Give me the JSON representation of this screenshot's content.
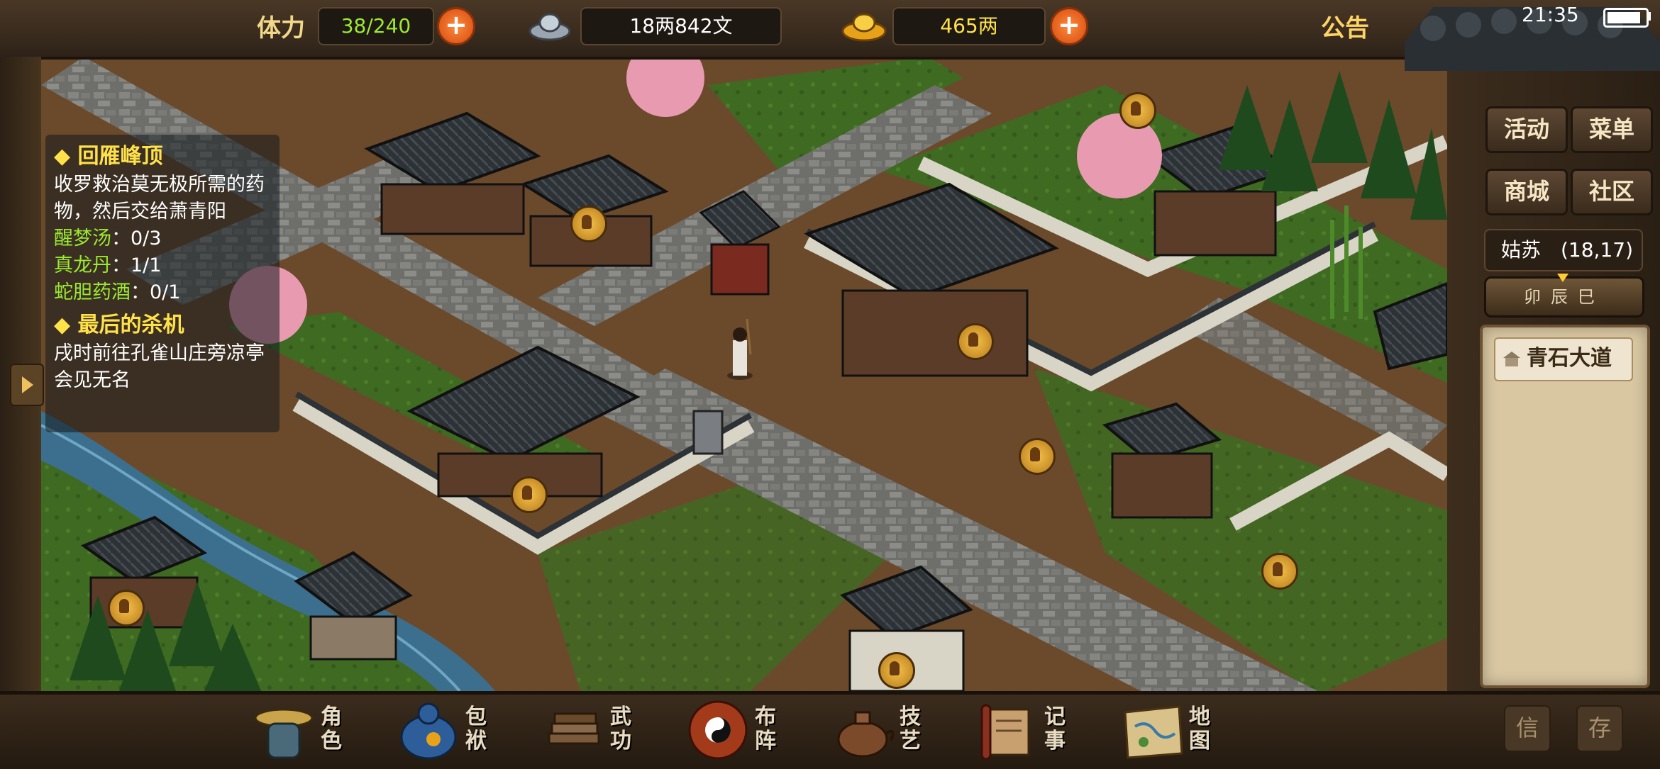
{
  "top_bar": {
    "stamina_label": "体力",
    "stamina_value": "38/240",
    "silver_value": "18两842文",
    "gold_value": "465两",
    "notice_label": "公告",
    "plus_symbol": "+",
    "clock": "21:35"
  },
  "quests": [
    {
      "title": "回雁峰顶",
      "desc": "收罗救治莫无极所需的药物，然后交给萧青阳",
      "items": [
        {
          "name": "醒梦汤",
          "count": "：0/3"
        },
        {
          "name": "真龙丹",
          "count": "：1/1"
        },
        {
          "name": "蛇胆药酒",
          "count": "：0/1"
        }
      ]
    },
    {
      "title": "最后的杀机",
      "desc": "戌时前往孔雀山庄旁凉亭会见无名"
    }
  ],
  "quest_bullet": "◆",
  "right_panel": {
    "buttons": [
      "活动",
      "菜单",
      "商城",
      "社区"
    ],
    "location_city": "姑苏",
    "location_coords": "(18,17)",
    "time_labels": "卯辰巳",
    "place_name": "青石大道",
    "side_buttons": [
      "信",
      "存"
    ]
  },
  "bottom_menu": [
    {
      "label": "角色",
      "icon": "character-icon"
    },
    {
      "label": "包袱",
      "icon": "bag-icon"
    },
    {
      "label": "武功",
      "icon": "martial-arts-icon"
    },
    {
      "label": "布阵",
      "icon": "formation-icon"
    },
    {
      "label": "技艺",
      "icon": "craft-icon"
    },
    {
      "label": "记事",
      "icon": "journal-icon"
    },
    {
      "label": "地图",
      "icon": "map-icon"
    }
  ],
  "colors": {
    "quest_title": "#ffe14a",
    "quest_item": "#9bea2f",
    "stamina_value": "#9bea2f",
    "gold_value": "#ffe14a",
    "plus_button": "#e05a14"
  }
}
